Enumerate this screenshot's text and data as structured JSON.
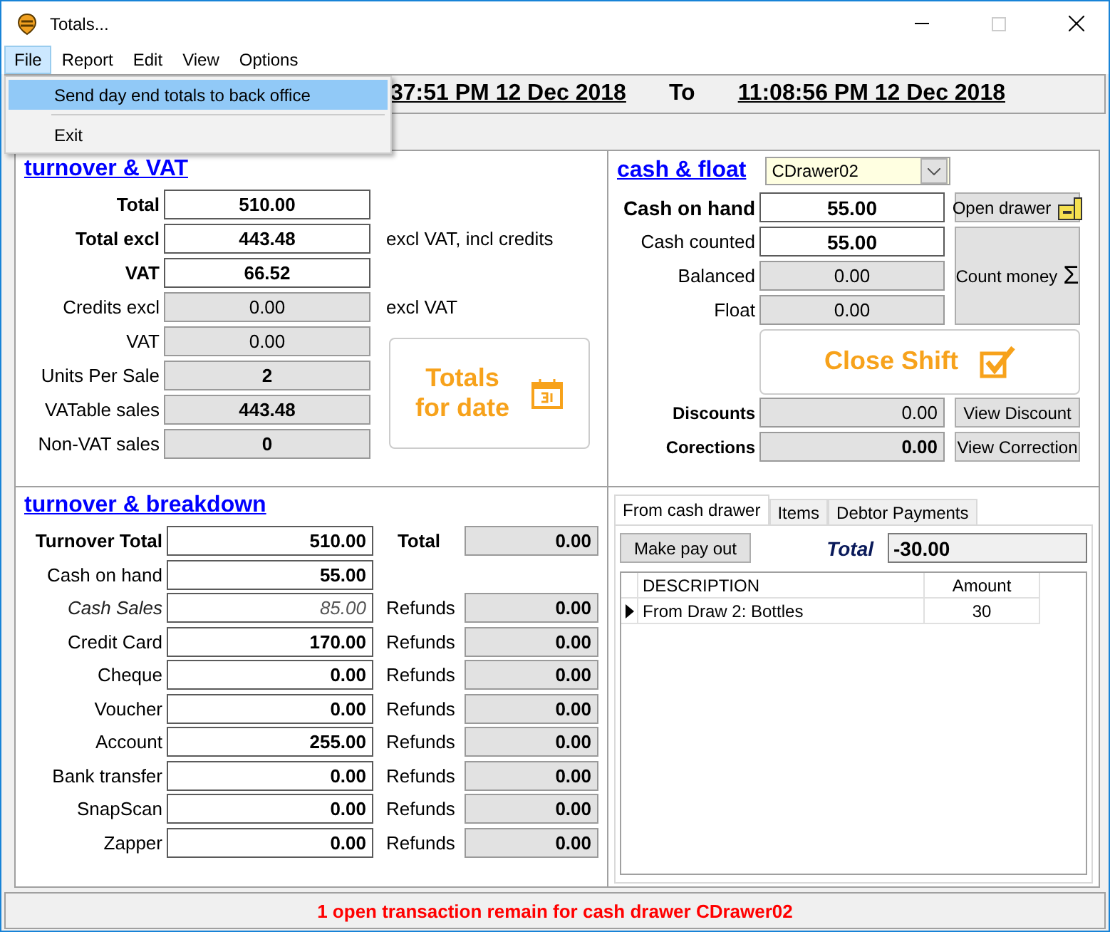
{
  "window": {
    "title": "Totals..."
  },
  "menu": [
    {
      "label": "File",
      "selected": true
    },
    {
      "label": "Report",
      "selected": false
    },
    {
      "label": "Edit",
      "selected": false
    },
    {
      "label": "View",
      "selected": false
    },
    {
      "label": "Options",
      "selected": false
    }
  ],
  "file_menu": [
    {
      "label": "Send day end totals to back office",
      "selected": true
    },
    {
      "label": "Exit",
      "selected": false
    }
  ],
  "period": {
    "from": "37:51 PM 12 Dec 2018",
    "separator": "To",
    "to": "11:08:56 PM 12 Dec 2018"
  },
  "turnover_vat": {
    "title": "turnover & VAT",
    "totals_button": [
      "Totals",
      "for date"
    ],
    "rows": [
      {
        "label": "Total",
        "value": "510.00",
        "label_bold": true,
        "value_bold": true,
        "readonly": false
      },
      {
        "label": "Total excl",
        "value": "443.48",
        "label_bold": true,
        "value_bold": true,
        "readonly": false,
        "note": "excl VAT, incl credits"
      },
      {
        "label": "VAT",
        "value": "66.52",
        "label_bold": true,
        "value_bold": true,
        "readonly": false
      },
      {
        "label": "Credits excl",
        "value": "0.00",
        "label_bold": false,
        "value_bold": false,
        "readonly": true,
        "note": "excl VAT"
      },
      {
        "label": "VAT",
        "value": "0.00",
        "label_bold": false,
        "value_bold": false,
        "readonly": true
      },
      {
        "label": "Units Per Sale",
        "value": "2",
        "label_bold": false,
        "value_bold": true,
        "readonly": true
      },
      {
        "label": "VATable sales",
        "value": "443.48",
        "label_bold": false,
        "value_bold": true,
        "readonly": true
      },
      {
        "label": "Non-VAT sales",
        "value": "0",
        "label_bold": false,
        "value_bold": true,
        "readonly": true
      }
    ]
  },
  "cash_float": {
    "title": "cash & float",
    "drawer": "CDrawer02",
    "rows": [
      {
        "label": "Cash on hand",
        "value": "55.00",
        "label_bold": true,
        "value_bold": true,
        "readonly": false
      },
      {
        "label": "Cash counted",
        "value": "55.00",
        "label_bold": false,
        "value_bold": true,
        "readonly": false
      },
      {
        "label": "Balanced",
        "value": "0.00",
        "label_bold": false,
        "value_bold": false,
        "readonly": true
      },
      {
        "label": "Float",
        "value": "0.00",
        "label_bold": false,
        "value_bold": false,
        "readonly": true
      }
    ],
    "open_drawer": "Open drawer",
    "count_money": "Count money",
    "count_symbol": "Σ",
    "close_shift": "Close Shift",
    "adjustments": [
      {
        "label": "Discounts",
        "value": "0.00",
        "value_bold": false,
        "button": "View Discount"
      },
      {
        "label": "Corections",
        "value": "0.00",
        "value_bold": true,
        "button": "View Correction"
      }
    ]
  },
  "breakdown": {
    "title": "turnover & breakdown",
    "rows": [
      {
        "kind": "total",
        "label": "Turnover Total",
        "value": "510.00",
        "side_label": "Total",
        "side_value": "0.00"
      },
      {
        "kind": "plain",
        "label": "Cash on hand",
        "value": "55.00"
      },
      {
        "kind": "italic",
        "label": "Cash Sales",
        "value": "85.00",
        "side_label": "Refunds",
        "side_value": "0.00"
      },
      {
        "kind": "plain",
        "label": "Credit Card",
        "value": "170.00",
        "side_label": "Refunds",
        "side_value": "0.00"
      },
      {
        "kind": "plain",
        "label": "Cheque",
        "value": "0.00",
        "side_label": "Refunds",
        "side_value": "0.00"
      },
      {
        "kind": "plain",
        "label": "Voucher",
        "value": "0.00",
        "side_label": "Refunds",
        "side_value": "0.00"
      },
      {
        "kind": "plain",
        "label": "Account",
        "value": "255.00",
        "side_label": "Refunds",
        "side_value": "0.00"
      },
      {
        "kind": "plain",
        "label": "Bank transfer",
        "value": "0.00",
        "side_label": "Refunds",
        "side_value": "0.00"
      },
      {
        "kind": "plain",
        "label": "SnapScan",
        "value": "0.00",
        "side_label": "Refunds",
        "side_value": "0.00"
      },
      {
        "kind": "plain",
        "label": "Zapper",
        "value": "0.00",
        "side_label": "Refunds",
        "side_value": "0.00"
      }
    ]
  },
  "payouts": {
    "tabs": [
      {
        "label": "From cash drawer",
        "selected": true
      },
      {
        "label": "Items",
        "selected": false
      },
      {
        "label": "Debtor Payments",
        "selected": false
      }
    ],
    "make_pay_out": "Make pay out",
    "total_label": "Total",
    "total_value": "-30.00",
    "columns": [
      "DESCRIPTION",
      "Amount"
    ],
    "rows": [
      {
        "cells": [
          "From Draw 2: Bottles",
          "30"
        ],
        "selected": true
      }
    ]
  },
  "status_bar": "1 open transaction remain for cash drawer CDrawer02"
}
